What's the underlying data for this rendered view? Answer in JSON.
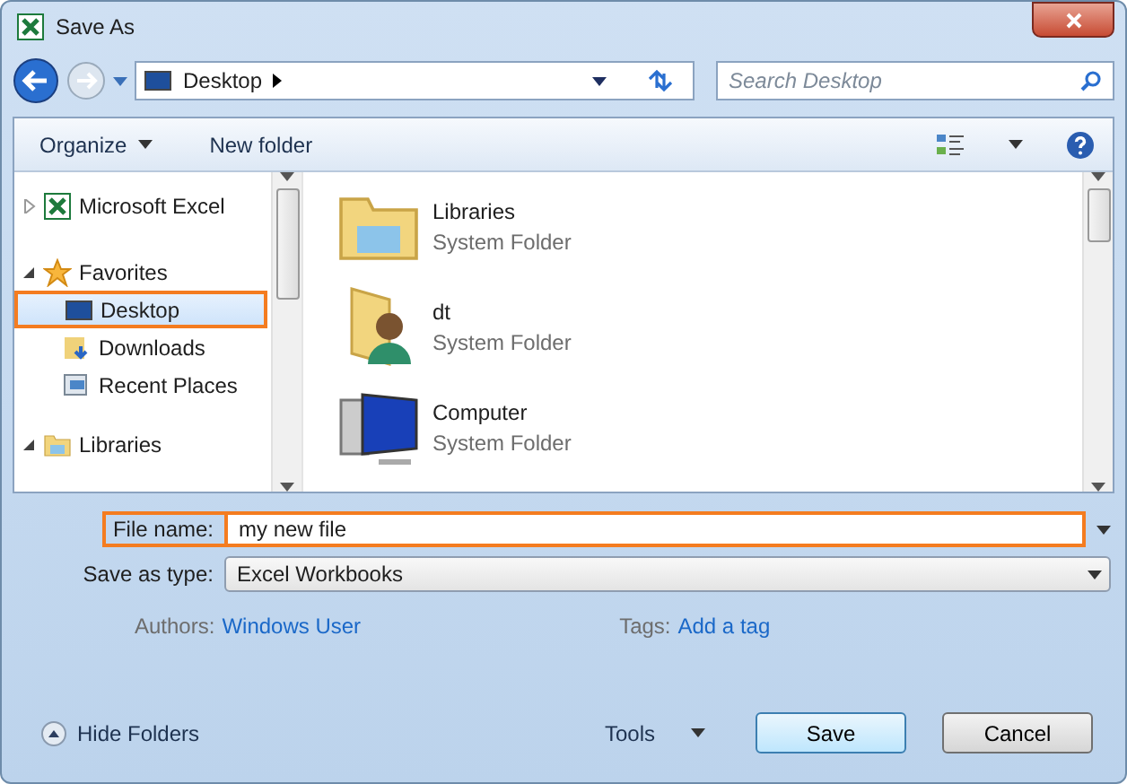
{
  "window": {
    "title": "Save As"
  },
  "address": {
    "location": "Desktop",
    "search_placeholder": "Search Desktop"
  },
  "toolbar": {
    "organize": "Organize",
    "new_folder": "New folder"
  },
  "nav": [
    {
      "label": "Microsoft Excel",
      "kind": "excel",
      "expanded": false,
      "selected": false,
      "highlighted": false
    },
    {
      "label": "Favorites",
      "kind": "star",
      "expanded": true,
      "selected": false,
      "highlighted": false,
      "children": [
        {
          "label": "Desktop",
          "kind": "desktop",
          "selected": true,
          "highlighted": true
        },
        {
          "label": "Downloads",
          "kind": "downloads",
          "selected": false,
          "highlighted": false
        },
        {
          "label": "Recent Places",
          "kind": "recent",
          "selected": false,
          "highlighted": false
        }
      ]
    },
    {
      "label": "Libraries",
      "kind": "libraries",
      "expanded": true,
      "selected": false,
      "highlighted": false
    }
  ],
  "files": [
    {
      "name": "Libraries",
      "type": "System Folder",
      "kind": "libraries"
    },
    {
      "name": "dt",
      "type": "System Folder",
      "kind": "user"
    },
    {
      "name": "Computer",
      "type": "System Folder",
      "kind": "computer"
    }
  ],
  "form": {
    "file_name_label": "File name:",
    "file_name": "my new file",
    "file_name_highlighted": true,
    "type_label": "Save as type:",
    "type_value": "Excel Workbooks"
  },
  "meta": {
    "authors_label": "Authors:",
    "authors": "Windows User",
    "tags_label": "Tags:",
    "tags": "Add a tag"
  },
  "footer": {
    "hide_folders": "Hide Folders",
    "tools": "Tools",
    "save": "Save",
    "cancel": "Cancel"
  }
}
